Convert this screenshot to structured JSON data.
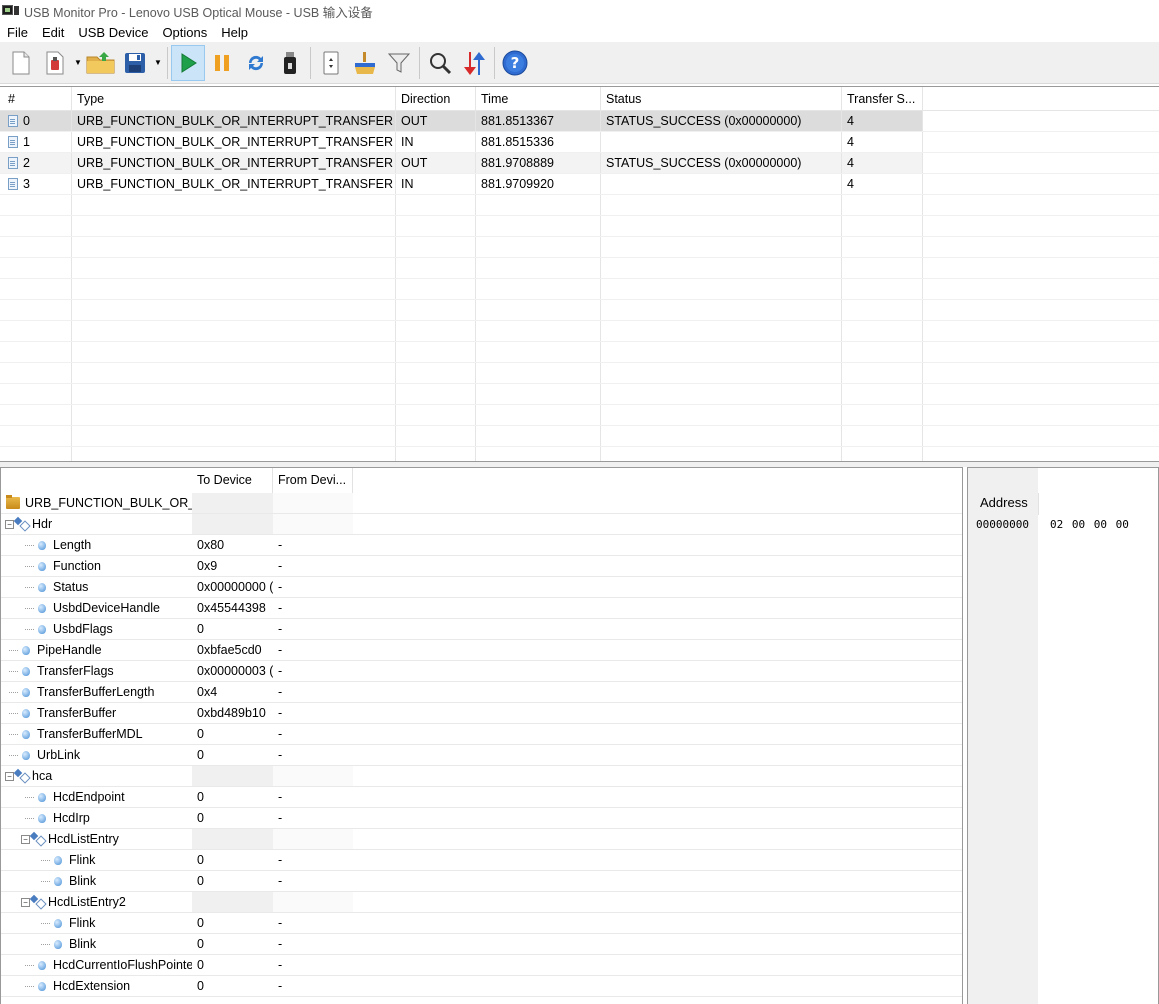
{
  "window": {
    "title": "USB Monitor Pro - Lenovo USB Optical Mouse - USB 输入设备"
  },
  "menu": [
    "File",
    "Edit",
    "USB Device",
    "Options",
    "Help"
  ],
  "toolbar": {
    "buttons": [
      "new-session-icon",
      "open-device-icon",
      "open-file-icon",
      "save-icon",
      "start-icon",
      "pause-icon",
      "refresh-icon",
      "usb-device-icon",
      "properties-icon",
      "clear-icon",
      "filter-icon",
      "find-icon",
      "sort-icon",
      "help-icon"
    ],
    "active": "start-icon",
    "colors": {
      "start": "#1ea04a",
      "pause": "#f0a020",
      "help": "#2f6bd0"
    }
  },
  "urb_grid": {
    "columns": [
      "#",
      "Type",
      "Direction",
      "Time",
      "Status",
      "Transfer S..."
    ],
    "rows": [
      {
        "num": "0",
        "type": "URB_FUNCTION_BULK_OR_INTERRUPT_TRANSFER",
        "direction": "OUT",
        "time": "881.8513367",
        "status": "STATUS_SUCCESS (0x00000000)",
        "transfer_size": "4"
      },
      {
        "num": "1",
        "type": "URB_FUNCTION_BULK_OR_INTERRUPT_TRANSFER",
        "direction": "IN",
        "time": "881.8515336",
        "status": "",
        "transfer_size": "4"
      },
      {
        "num": "2",
        "type": "URB_FUNCTION_BULK_OR_INTERRUPT_TRANSFER",
        "direction": "OUT",
        "time": "881.9708889",
        "status": "STATUS_SUCCESS (0x00000000)",
        "transfer_size": "4"
      },
      {
        "num": "3",
        "type": "URB_FUNCTION_BULK_OR_INTERRUPT_TRANSFER",
        "direction": "IN",
        "time": "881.9709920",
        "status": "",
        "transfer_size": "4"
      }
    ],
    "empty_rows": 13
  },
  "tree": {
    "columns": [
      "",
      "To Device",
      "From Devi..."
    ],
    "root": "URB_FUNCTION_BULK_OR_IN",
    "rows": [
      {
        "label": "Hdr",
        "to": "",
        "from": "",
        "kind": "group",
        "depth": 0
      },
      {
        "label": "Length",
        "to": "0x80",
        "from": "-",
        "kind": "leaf",
        "depth": 1
      },
      {
        "label": "Function",
        "to": "0x9",
        "from": "-",
        "kind": "leaf",
        "depth": 1
      },
      {
        "label": "Status",
        "to": "0x00000000 (",
        "from": "-",
        "kind": "leaf",
        "depth": 1
      },
      {
        "label": "UsbdDeviceHandle",
        "to": "0x45544398",
        "from": "-",
        "kind": "leaf",
        "depth": 1
      },
      {
        "label": "UsbdFlags",
        "to": "0",
        "from": "-",
        "kind": "leaf",
        "depth": 1
      },
      {
        "label": "PipeHandle",
        "to": "0xbfae5cd0",
        "from": "-",
        "kind": "leaf",
        "depth": 0
      },
      {
        "label": "TransferFlags",
        "to": "0x00000003 (",
        "from": "-",
        "kind": "leaf",
        "depth": 0
      },
      {
        "label": "TransferBufferLength",
        "to": "0x4",
        "from": "-",
        "kind": "leaf",
        "depth": 0
      },
      {
        "label": "TransferBuffer",
        "to": "0xbd489b10",
        "from": "-",
        "kind": "leaf",
        "depth": 0
      },
      {
        "label": "TransferBufferMDL",
        "to": "0",
        "from": "-",
        "kind": "leaf",
        "depth": 0
      },
      {
        "label": "UrbLink",
        "to": "0",
        "from": "-",
        "kind": "leaf",
        "depth": 0
      },
      {
        "label": "hca",
        "to": "",
        "from": "",
        "kind": "group",
        "depth": 0
      },
      {
        "label": "HcdEndpoint",
        "to": "0",
        "from": "-",
        "kind": "leaf",
        "depth": 1
      },
      {
        "label": "HcdIrp",
        "to": "0",
        "from": "-",
        "kind": "leaf",
        "depth": 1
      },
      {
        "label": "HcdListEntry",
        "to": "",
        "from": "",
        "kind": "group",
        "depth": 1
      },
      {
        "label": "Flink",
        "to": "0",
        "from": "-",
        "kind": "leaf",
        "depth": 2
      },
      {
        "label": "Blink",
        "to": "0",
        "from": "-",
        "kind": "leaf",
        "depth": 2
      },
      {
        "label": "HcdListEntry2",
        "to": "",
        "from": "",
        "kind": "group",
        "depth": 1
      },
      {
        "label": "Flink",
        "to": "0",
        "from": "-",
        "kind": "leaf",
        "depth": 2
      },
      {
        "label": "Blink",
        "to": "0",
        "from": "-",
        "kind": "leaf",
        "depth": 2
      },
      {
        "label": "HcdCurrentIoFlushPointer",
        "to": "0",
        "from": "-",
        "kind": "leaf",
        "depth": 1
      },
      {
        "label": "HcdExtension",
        "to": "0",
        "from": "-",
        "kind": "leaf",
        "depth": 1
      }
    ]
  },
  "hex": {
    "address_label": "Address",
    "address": "00000000",
    "bytes": "02 00 00 00"
  }
}
